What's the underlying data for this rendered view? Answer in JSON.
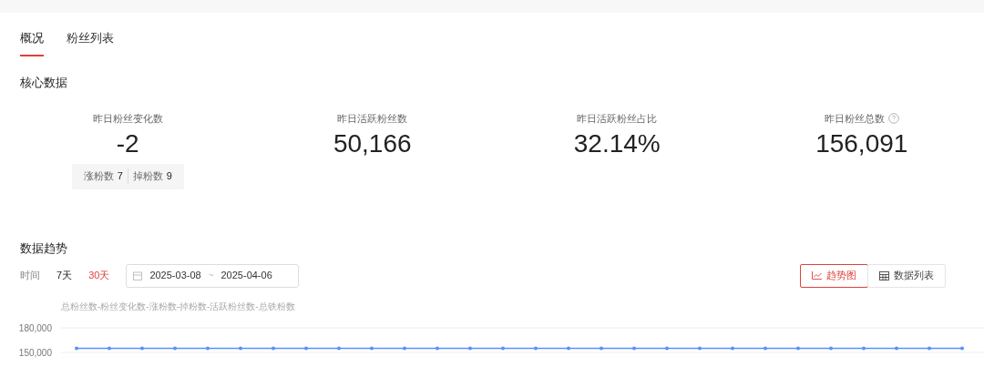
{
  "tabs": [
    {
      "label": "概况",
      "selected": true
    },
    {
      "label": "粉丝列表",
      "selected": false
    }
  ],
  "core": {
    "title": "核心数据",
    "stats": [
      {
        "label": "昨日粉丝变化数",
        "value": "-2",
        "help": false,
        "breakdown": [
          {
            "label": "涨粉数",
            "value": "7"
          },
          {
            "label": "掉粉数",
            "value": "9"
          }
        ]
      },
      {
        "label": "昨日活跃粉丝数",
        "value": "50,166",
        "help": false
      },
      {
        "label": "昨日活跃粉丝占比",
        "value": "32.14%",
        "help": false
      },
      {
        "label": "昨日粉丝总数",
        "value": "156,091",
        "help": true
      }
    ]
  },
  "trend": {
    "title": "数据趋势",
    "time_label": "时间",
    "ranges": [
      {
        "label": "7天",
        "selected": false
      },
      {
        "label": "30天",
        "selected": true
      }
    ],
    "date_start": "2025-03-08",
    "date_sep": "~",
    "date_end": "2025-04-06",
    "views": [
      {
        "label": "趋势图",
        "kind": "chart",
        "selected": true
      },
      {
        "label": "数据列表",
        "kind": "table",
        "selected": false
      }
    ],
    "legend": "总粉丝数-粉丝变化数-涨粉数-掉粉数-活跃粉丝数-总铁粉数",
    "chart_data": {
      "type": "line",
      "ylim": [
        150000,
        180000
      ],
      "yticks": [
        {
          "value": 150000,
          "label": "150,000"
        },
        {
          "value": 180000,
          "label": "180,000"
        }
      ],
      "series": [
        {
          "color": "#5b8ff9",
          "values": [
            155000,
            155000,
            155000,
            155000,
            155000,
            155000,
            155000,
            155000,
            155000,
            155000,
            155000,
            155000,
            155000,
            155000,
            155000,
            155000,
            155000,
            155000,
            155000,
            155000,
            155000,
            155000,
            155000,
            155000,
            155000,
            155000,
            155000,
            155000
          ]
        }
      ]
    }
  }
}
